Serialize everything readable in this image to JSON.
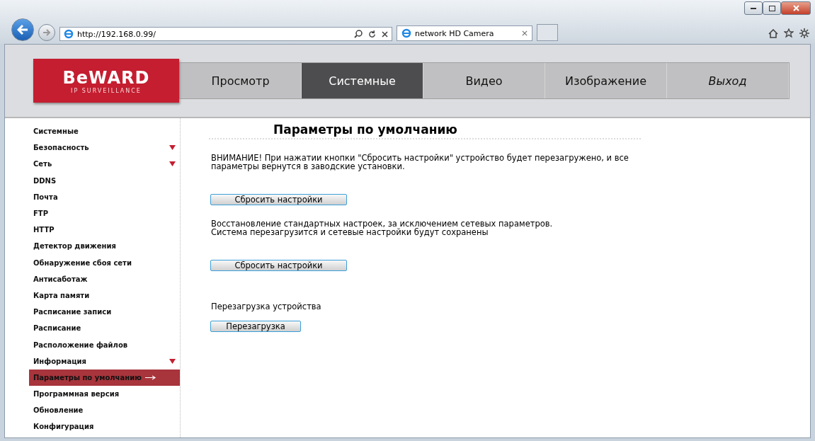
{
  "browser": {
    "address": "http://192.168.0.99/",
    "tab_title": "network HD Camera"
  },
  "logo": {
    "brand": "BeWARD",
    "tagline": "IP SURVEILLANCE"
  },
  "nav": [
    {
      "label": "Просмотр",
      "selected": false,
      "kind": "normal"
    },
    {
      "label": "Системные",
      "selected": true,
      "kind": "normal"
    },
    {
      "label": "Видео",
      "selected": false,
      "kind": "normal"
    },
    {
      "label": "Изображение",
      "selected": false,
      "kind": "normal"
    },
    {
      "label": "Выход",
      "selected": false,
      "kind": "exit"
    }
  ],
  "sidebar": {
    "items": [
      {
        "label": "Системные",
        "expandable": false,
        "selected": false
      },
      {
        "label": "Безопасность",
        "expandable": true,
        "selected": false
      },
      {
        "label": "Сеть",
        "expandable": true,
        "selected": false
      },
      {
        "label": "DDNS",
        "expandable": false,
        "selected": false
      },
      {
        "label": "Почта",
        "expandable": false,
        "selected": false
      },
      {
        "label": "FTP",
        "expandable": false,
        "selected": false
      },
      {
        "label": "HTTP",
        "expandable": false,
        "selected": false
      },
      {
        "label": "Детектор движения",
        "expandable": false,
        "selected": false
      },
      {
        "label": "Обнаружение сбоя сети",
        "expandable": false,
        "selected": false
      },
      {
        "label": "Антисаботаж",
        "expandable": false,
        "selected": false
      },
      {
        "label": "Карта памяти",
        "expandable": false,
        "selected": false
      },
      {
        "label": "Расписание записи",
        "expandable": false,
        "selected": false
      },
      {
        "label": "Расписание",
        "expandable": false,
        "selected": false
      },
      {
        "label": "Расположение файлов",
        "expandable": false,
        "selected": false
      },
      {
        "label": "Информация",
        "expandable": true,
        "selected": false
      },
      {
        "label": "Параметры по умолчанию",
        "expandable": false,
        "selected": true
      },
      {
        "label": "Программная версия",
        "expandable": false,
        "selected": false
      },
      {
        "label": "Обновление",
        "expandable": false,
        "selected": false
      },
      {
        "label": "Конфигурация",
        "expandable": false,
        "selected": false
      }
    ]
  },
  "content": {
    "title": "Параметры по умолчанию",
    "sections": [
      {
        "text": "ВНИМАНИЕ! При нажатии кнопки \"Сбросить настройки\" устройство будет перезагружено, и все параметры вернутся в заводские установки.",
        "button": "Сбросить настройки",
        "kind": "wide"
      },
      {
        "text": "Восстановление стандартных настроек, за исключением сетевых параметров.\nСистема перезагрузится и сетевые настройки будут сохранены",
        "button": "Сбросить настройки",
        "kind": "wide"
      },
      {
        "text": "Перезагрузка устройства",
        "button": "Перезагрузка",
        "kind": "narrow"
      }
    ]
  }
}
